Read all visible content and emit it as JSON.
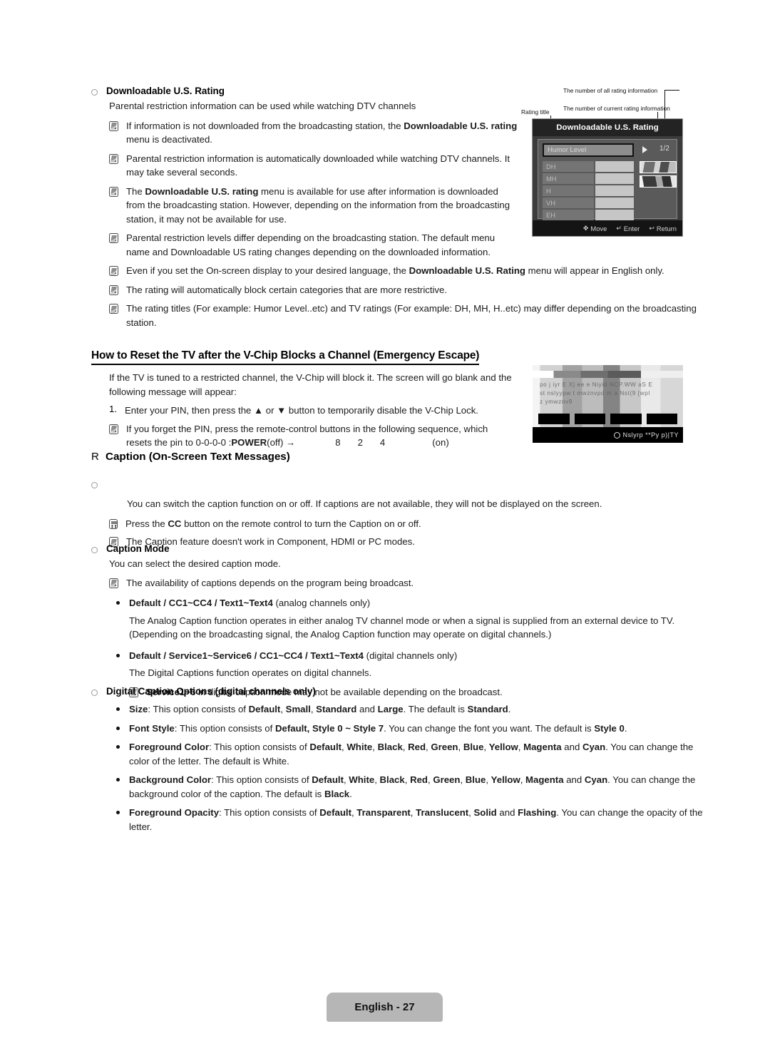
{
  "document": {
    "footer_label": "English - 27"
  },
  "section_downloadable": {
    "heading": "Downloadable U.S. Rating",
    "intro": "Parental restriction information can be used while watching DTV channels",
    "notes": [
      {
        "parts": [
          {
            "t": "If information is not downloaded from the broadcasting station, the ",
            "b": false
          },
          {
            "t": "Downloadable U.S. rating",
            "b": true
          },
          {
            "t": " menu is deactivated.",
            "b": false
          }
        ]
      },
      {
        "parts": [
          {
            "t": "Parental restriction information is automatically downloaded while watching DTV channels. It may take several seconds.",
            "b": false
          }
        ]
      },
      {
        "parts": [
          {
            "t": "The ",
            "b": false
          },
          {
            "t": "Downloadable U.S. rating",
            "b": true
          },
          {
            "t": " menu is available for use after information is downloaded from the broadcasting station. However, depending on the information from the broadcasting station, it may not be available for use.",
            "b": false
          }
        ]
      },
      {
        "parts": [
          {
            "t": "Parental restriction levels differ depending on the broadcasting station. The default menu name and Downloadable US rating changes depending on the downloaded information.",
            "b": false
          }
        ]
      },
      {
        "parts": [
          {
            "t": "Even if you set the On-screen display to your desired language, the ",
            "b": false
          },
          {
            "t": "Downloadable U.S. Rating",
            "b": true
          },
          {
            "t": " menu will appear in English only.",
            "b": false
          }
        ]
      },
      {
        "parts": [
          {
            "t": "The rating will automatically block certain categories that are more restrictive.",
            "b": false
          }
        ]
      },
      {
        "parts": [
          {
            "t": "The rating titles (For example: Humor Level..etc) and TV ratings (For example: DH, MH, H..etc) may differ depending on the broadcasting station.",
            "b": false
          }
        ]
      }
    ]
  },
  "osd_menu": {
    "title": "Downloadable U.S. Rating",
    "selected_item": "Humor Level",
    "page_counter": "1/2",
    "rating_rows": [
      "DH",
      "MH",
      "H",
      "VH",
      "EH"
    ],
    "footer": [
      {
        "glyph": "✥",
        "label": "Move"
      },
      {
        "glyph": "↵",
        "label": "Enter"
      },
      {
        "glyph": "↩",
        "label": "Return"
      }
    ],
    "annotations": {
      "rating_title": "Rating title",
      "all_rating": "The number of all rating information",
      "current_rating": "The number of current rating information"
    }
  },
  "section_vchip": {
    "heading": "How to Reset the TV after the V-Chip Blocks a Channel (Emergency Escape)",
    "intro": "If the TV is tuned to a restricted channel, the V-Chip will block it. The screen will go blank and the following message will appear:",
    "step_number": "1.",
    "step_text": "Enter your PIN, then press the ▲ or ▼ button to temporarily disable the V-Chip Lock.",
    "note_line1": "If you forget the PIN, press the remote-control buttons in the following sequence, which",
    "note_line2_pre": "resets the pin to 0-0-0-0 : ",
    "note_power_bold": "POWER",
    "note_off": " (off) →",
    "note_keys": [
      "8",
      "2",
      "4"
    ],
    "note_on": "(on)",
    "blocked_screen": {
      "line1": "po  j  iyr E  X] ee  e  Niyid NCP.WW  aS E",
      "line2": "st  nslyypw t  mwznvpd  m   a Nst(9 [wpl",
      "line3": "z  ymwznv9",
      "bottom_text": "Nslyrp     **Py p)|TY"
    }
  },
  "section_caption": {
    "marker": "R",
    "heading": "Caption (On-Screen Text Messages)",
    "sub_heading": "",
    "intro": "You can switch the caption function on or off. If captions are not available, they will not be displayed on the screen.",
    "notes": [
      {
        "icon": "remote",
        "parts": [
          {
            "t": "Press the ",
            "b": false
          },
          {
            "t": "CC",
            "b": true
          },
          {
            "t": " button on the remote control to turn the Caption on or off.",
            "b": false
          }
        ]
      },
      {
        "icon": "note",
        "parts": [
          {
            "t": "The Caption feature doesn't work in Component, HDMI or PC modes.",
            "b": false
          }
        ]
      }
    ]
  },
  "section_caption_mode": {
    "heading": "Caption Mode",
    "intro": "You can select the desired caption mode.",
    "note": "The availability of captions depends on the program being broadcast.",
    "bullets": [
      {
        "parts": [
          {
            "t": "Default / CC1~CC4 / Text1~Text4",
            "b": true
          },
          {
            "t": " (analog channels only)",
            "b": false
          }
        ],
        "body": "The Analog Caption function operates in either analog TV channel mode or when a signal is supplied from an external device to TV. (Depending on the broadcasting signal, the Analog Caption function may operate on digital channels.)"
      },
      {
        "parts": [
          {
            "t": "Default / Service1~Service6 / CC1~CC4 / Text1~Text4",
            "b": true
          },
          {
            "t": " (digital channels only)",
            "b": false
          }
        ],
        "body": "The Digital Captions function operates on digital channels."
      }
    ],
    "sub_note_parts": [
      {
        "t": "Service1~6",
        "b": true
      },
      {
        "t": " in digital caption mode may not be available depending on the broadcast.",
        "b": false
      }
    ]
  },
  "section_digital_options": {
    "heading": "Digital Caption Options (digital channels only)",
    "bullets": [
      {
        "parts": [
          {
            "t": "Size",
            "b": true
          },
          {
            "t": ": This option consists of ",
            "b": false
          },
          {
            "t": "Default",
            "b": true
          },
          {
            "t": ", ",
            "b": false
          },
          {
            "t": "Small",
            "b": true
          },
          {
            "t": ", ",
            "b": false
          },
          {
            "t": "Standard",
            "b": true
          },
          {
            "t": " and ",
            "b": false
          },
          {
            "t": "Large",
            "b": true
          },
          {
            "t": ". The default is ",
            "b": false
          },
          {
            "t": "Standard",
            "b": true
          },
          {
            "t": ".",
            "b": false
          }
        ]
      },
      {
        "parts": [
          {
            "t": "Font Style",
            "b": true
          },
          {
            "t": ": This option consists of ",
            "b": false
          },
          {
            "t": "Default, Style 0 ~ Style 7",
            "b": true
          },
          {
            "t": ". You can change the font you want. The default is ",
            "b": false
          },
          {
            "t": "Style 0",
            "b": true
          },
          {
            "t": ".",
            "b": false
          }
        ]
      },
      {
        "parts": [
          {
            "t": "Foreground Color",
            "b": true
          },
          {
            "t": ": This option consists of ",
            "b": false
          },
          {
            "t": "Default",
            "b": true
          },
          {
            "t": ", ",
            "b": false
          },
          {
            "t": "White",
            "b": true
          },
          {
            "t": ", ",
            "b": false
          },
          {
            "t": "Black",
            "b": true
          },
          {
            "t": ", ",
            "b": false
          },
          {
            "t": "Red",
            "b": true
          },
          {
            "t": ", ",
            "b": false
          },
          {
            "t": "Green",
            "b": true
          },
          {
            "t": ", ",
            "b": false
          },
          {
            "t": "Blue",
            "b": true
          },
          {
            "t": ", ",
            "b": false
          },
          {
            "t": "Yellow",
            "b": true
          },
          {
            "t": ", ",
            "b": false
          },
          {
            "t": "Magenta",
            "b": true
          },
          {
            "t": " and ",
            "b": false
          },
          {
            "t": "Cyan",
            "b": true
          },
          {
            "t": ". You can change the color of the letter. The default is White.",
            "b": false
          }
        ]
      },
      {
        "parts": [
          {
            "t": "Background Color",
            "b": true
          },
          {
            "t": ": This option consists of ",
            "b": false
          },
          {
            "t": "Default",
            "b": true
          },
          {
            "t": ", ",
            "b": false
          },
          {
            "t": "White",
            "b": true
          },
          {
            "t": ", ",
            "b": false
          },
          {
            "t": "Black",
            "b": true
          },
          {
            "t": ", ",
            "b": false
          },
          {
            "t": "Red",
            "b": true
          },
          {
            "t": ", ",
            "b": false
          },
          {
            "t": "Green",
            "b": true
          },
          {
            "t": ", ",
            "b": false
          },
          {
            "t": "Blue",
            "b": true
          },
          {
            "t": ", ",
            "b": false
          },
          {
            "t": "Yellow",
            "b": true
          },
          {
            "t": ", ",
            "b": false
          },
          {
            "t": "Magenta",
            "b": true
          },
          {
            "t": " and ",
            "b": false
          },
          {
            "t": "Cyan",
            "b": true
          },
          {
            "t": ". You can change the background color of the caption. The default is ",
            "b": false
          },
          {
            "t": "Black",
            "b": true
          },
          {
            "t": ".",
            "b": false
          }
        ]
      },
      {
        "parts": [
          {
            "t": "Foreground Opacity",
            "b": true
          },
          {
            "t": ": This option consists of ",
            "b": false
          },
          {
            "t": "Default",
            "b": true
          },
          {
            "t": ", ",
            "b": false
          },
          {
            "t": "Transparent",
            "b": true
          },
          {
            "t": ", ",
            "b": false
          },
          {
            "t": "Translucent",
            "b": true
          },
          {
            "t": ", ",
            "b": false
          },
          {
            "t": "Solid",
            "b": true
          },
          {
            "t": " and ",
            "b": false
          },
          {
            "t": "Flashing",
            "b": true
          },
          {
            "t": ". You can change the opacity of the letter.",
            "b": false
          }
        ]
      }
    ]
  }
}
